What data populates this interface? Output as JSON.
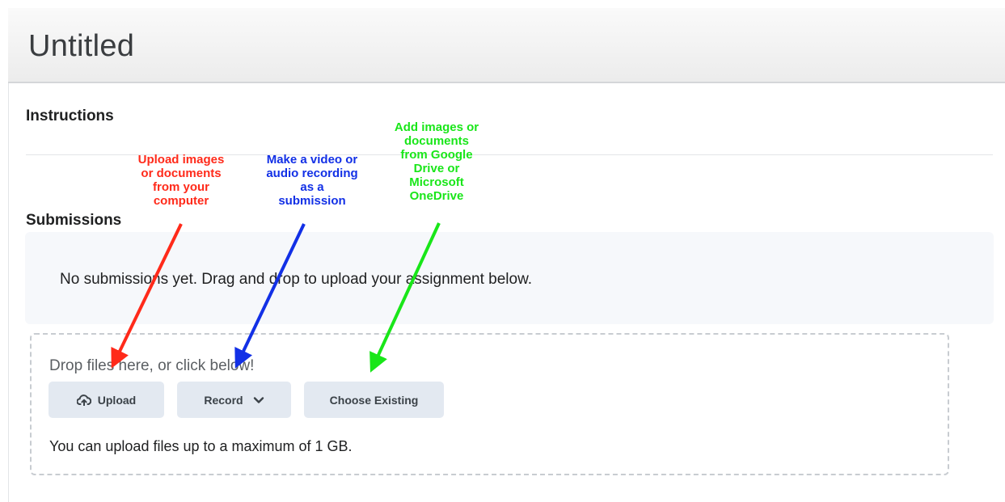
{
  "page": {
    "title": "Untitled"
  },
  "instructions": {
    "heading": "Instructions"
  },
  "submissions": {
    "heading": "Submissions",
    "empty_message": "No submissions yet. Drag and drop to upload your assignment below."
  },
  "dropzone": {
    "hint": "Drop files here, or click below!",
    "upload_label": "Upload",
    "record_label": "Record",
    "choose_existing_label": "Choose Existing",
    "max_size_note": "You can upload files up to a maximum of 1 GB."
  },
  "annotations": {
    "upload": {
      "text": "Upload images\nor documents\nfrom your\ncomputer",
      "color": "#ff2a1a"
    },
    "record": {
      "text": "Make a video or\naudio recording\nas a\nsubmission",
      "color": "#1230e6"
    },
    "choose": {
      "text": "Add images or\ndocuments\nfrom Google\nDrive or\nMicrosoft\nOneDrive",
      "color": "#19e619"
    }
  },
  "icons": {
    "upload": "cloud-upload-icon",
    "record": "chevron-down-icon"
  }
}
